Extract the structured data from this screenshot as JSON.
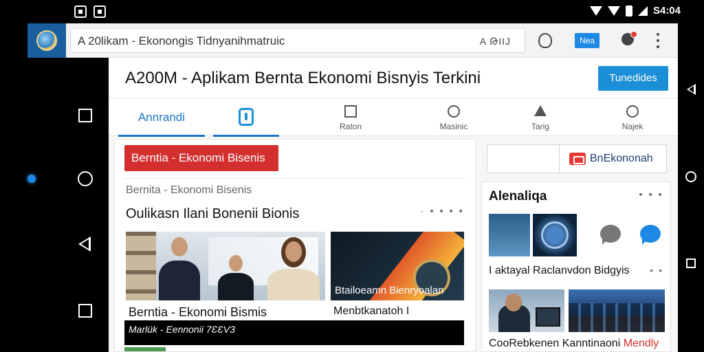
{
  "status_bar": {
    "time": "S4:04"
  },
  "browser": {
    "url_text": "A 20likam - Ekonongis Tidnyanihmatruiс",
    "url_right": "A ԹIIJ",
    "badge_label": "Nea"
  },
  "page": {
    "title": "A200M - Aplikam Bernta Ekonomi Bisnyis Terkini",
    "header_button": "Tunedides",
    "tabs": [
      {
        "label": "Annrandi",
        "icon": "home-icon",
        "active": true
      },
      {
        "label": "",
        "icon": "badge-icon",
        "active": false
      },
      {
        "label": "Raton",
        "icon": "mail-icon",
        "active": false
      },
      {
        "label": "Masinic",
        "icon": "search-icon",
        "active": false
      },
      {
        "label": "Tarig",
        "icon": "triangle-icon",
        "active": false
      },
      {
        "label": "Najek",
        "icon": "user-icon",
        "active": false
      }
    ]
  },
  "main": {
    "chip": "Berntia - Ekonomi Bisenis",
    "section_label": "Bernita - Ekonomi Bisenis",
    "section_heading": "Oulikasn Ilani Bonenii Bionis",
    "section_more": "· • • • •",
    "card1_caption": "Berntia - Ekonomi Bismis",
    "card2_overlay": "Btailoeamn Bienryoalan",
    "card2_caption": "Menbtkanatoh I",
    "black_bar_text": "Marlük - Eennonii 7ƐƐV3"
  },
  "side": {
    "top_button": "BnEkononah",
    "heading": "Alenaliqa",
    "heading_more": "• • •",
    "caption1": "I aktayal Raclanvdon Bidgyis",
    "caption1_more": "• •",
    "bottom_text": "CooRebkenen Kanntinaoni",
    "bottom_red": "Mendly"
  },
  "colors": {
    "accent": "#1a73c8",
    "header_button": "#1b8fd6",
    "chip": "#d32f2f"
  }
}
